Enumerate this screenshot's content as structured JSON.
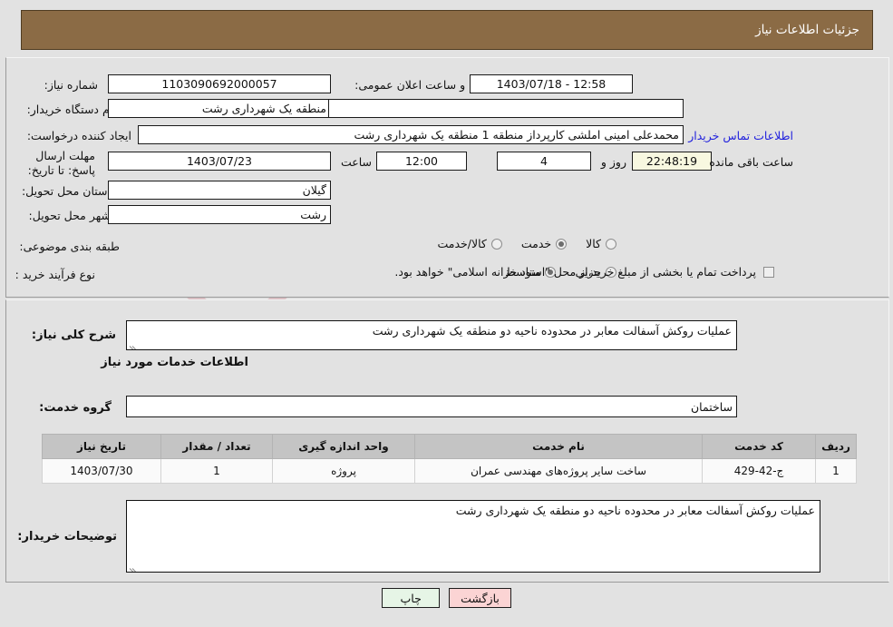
{
  "header": {
    "title": "جزئیات اطلاعات نیاز"
  },
  "watermark": {
    "text": "AriaTender.net"
  },
  "top_section": {
    "need_number": {
      "label": "شماره نیاز:",
      "value": "1103090692000057"
    },
    "announce_datetime": {
      "label": "تاریخ و ساعت اعلان عمومی:",
      "value": "1403/07/18 - 12:58"
    },
    "buyer_org": {
      "label": "نام دستگاه خریدار:",
      "value": "منطقه یک شهرداری رشت"
    },
    "empty_field": {
      "value": ""
    },
    "creator": {
      "label": "ایجاد کننده درخواست:",
      "value": "محمدعلی امینی املشی کارپرداز منطقه 1 منطقه یک شهرداری رشت"
    },
    "contact_link": {
      "label": "اطلاعات تماس خریدار"
    },
    "deadline": {
      "label": "مهلت ارسال پاسخ: تا تاریخ:",
      "date": "1403/07/23",
      "time_label": "ساعت",
      "time": "12:00",
      "days": "4",
      "days_label": "روز و",
      "countdown": "22:48:19",
      "remaining_label": "ساعت باقی مانده"
    },
    "province": {
      "label": "استان محل تحویل:",
      "value": "گیلان"
    },
    "city": {
      "label": "شهر محل تحویل:",
      "value": "رشت"
    },
    "subject_category": {
      "label": "طبقه بندی موضوعی:",
      "options": [
        {
          "label": "کالا",
          "selected": false
        },
        {
          "label": "خدمت",
          "selected": true
        },
        {
          "label": "کالا/خدمت",
          "selected": false
        }
      ]
    },
    "purchase_type": {
      "label": "نوع فرآیند خرید :",
      "options": [
        {
          "label": "جزیی",
          "selected": false
        },
        {
          "label": "متوسط",
          "selected": true
        }
      ],
      "checkbox_label": "پرداخت تمام یا بخشی از مبلغ خرید،از محل \"اسناد خزانه اسلامی\" خواهد بود.",
      "checkbox_checked": false
    }
  },
  "bottom_section": {
    "general_desc": {
      "label": "شرح کلی نیاز:",
      "value": "عملیات روکش آسفالت معابر در محدوده ناحیه دو منطقه یک شهرداری رشت"
    },
    "services_heading": "اطلاعات خدمات مورد نیاز",
    "service_group": {
      "label": "گروه خدمت:",
      "value": "ساختمان"
    },
    "table": {
      "columns": [
        "ردیف",
        "کد خدمت",
        "نام خدمت",
        "واحد اندازه گیری",
        "تعداد / مقدار",
        "تاریخ نیاز"
      ],
      "rows": [
        {
          "index": "1",
          "code": "ج-42-429",
          "name": "ساخت سایر پروژه‌های مهندسی عمران",
          "unit": "پروژه",
          "quantity": "1",
          "need_date": "1403/07/30"
        }
      ]
    },
    "buyer_notes": {
      "label": "توضیحات خریدار:",
      "value": "عملیات روکش آسفالت معابر در محدوده ناحیه دو منطقه یک شهرداری رشت"
    }
  },
  "footer": {
    "print_button": "چاپ",
    "back_button": "بازگشت"
  }
}
